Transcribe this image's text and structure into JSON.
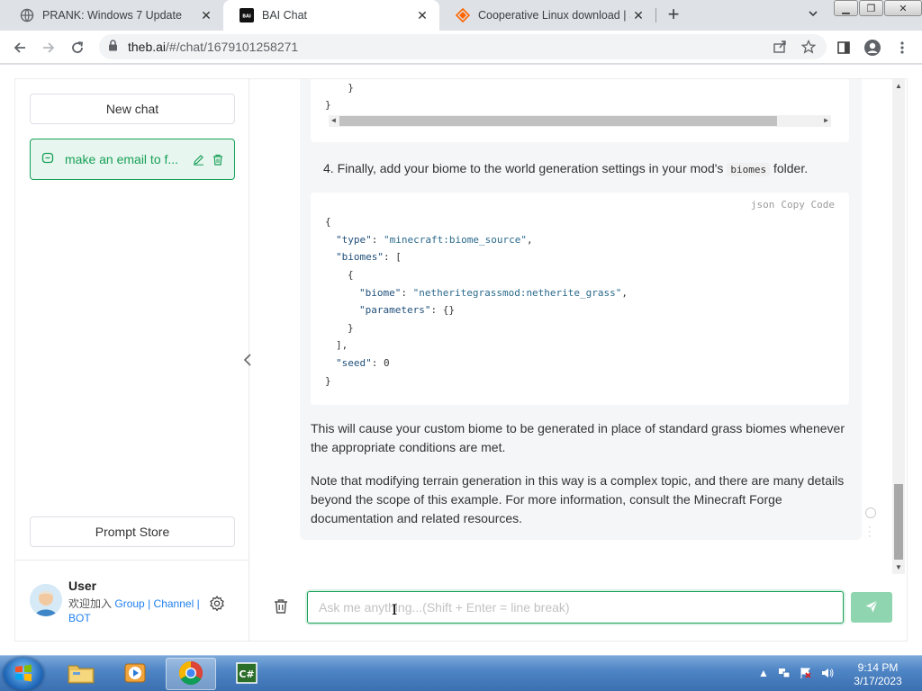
{
  "browser": {
    "tabs": [
      {
        "title": "PRANK: Windows 7 Update",
        "active": false
      },
      {
        "title": "BAI Chat",
        "active": true
      },
      {
        "title": "Cooperative Linux download | So",
        "active": false
      }
    ],
    "url_host": "theb.ai",
    "url_path": "/#/chat/1679101258271"
  },
  "sidebar": {
    "new_chat_label": "New chat",
    "chat_items": [
      {
        "label": "make an email to f..."
      }
    ],
    "prompt_store_label": "Prompt Store",
    "user": {
      "name": "User",
      "join_text": "欢迎加入",
      "link_group": "Group",
      "sep1": "|",
      "link_channel": "Channel",
      "sep2": "|",
      "link_bot": "BOT"
    }
  },
  "chat": {
    "code_top_lines": [
      "  }",
      "}"
    ],
    "step4_prefix": "4. Finally, add your biome to the world generation settings in your mod's",
    "step4_code": "biomes",
    "step4_suffix": "folder.",
    "code_lang": "json",
    "code_copy": "Copy Code",
    "json_lines": {
      "l1": "{",
      "l2_key": "\"type\"",
      "l2_val": "\"minecraft:biome_source\"",
      "l3_key": "\"biomes\"",
      "l3_rest": ": [",
      "l4": "{",
      "l5_key": "\"biome\"",
      "l5_val": "\"netheritegrassmod:netherite_grass\"",
      "l6_key": "\"parameters\"",
      "l6_rest": ": {}",
      "l7": "}",
      "l8": "],",
      "l9_key": "\"seed\"",
      "l9_val": "0",
      "l10": "}"
    },
    "paragraph1": "This will cause your custom biome to be generated in place of standard grass biomes whenever the appropriate conditions are met.",
    "paragraph2": "Note that modifying terrain generation in this way is a complex topic, and there are many details beyond the scope of this example. For more information, consult the Minecraft Forge documentation and related resources."
  },
  "input": {
    "placeholder": "Ask me anything...(Shift + Enter = line break)",
    "value": ""
  },
  "taskbar": {
    "time": "9:14 PM",
    "date": "3/17/2023"
  },
  "colors": {
    "accent": "#18a058",
    "link": "#2080f0"
  }
}
